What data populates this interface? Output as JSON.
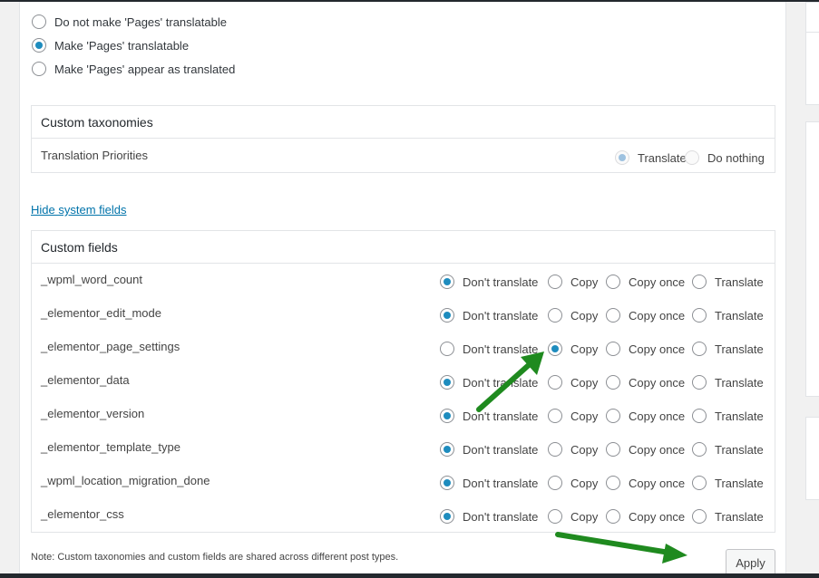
{
  "post_type_options": [
    {
      "label": "Do not make 'Pages' translatable",
      "checked": false
    },
    {
      "label": "Make 'Pages' translatable",
      "checked": true
    },
    {
      "label": "Make 'Pages' appear as translated",
      "checked": false
    }
  ],
  "custom_taxonomies": {
    "title": "Custom taxonomies",
    "row_name": "Translation Priorities",
    "options": [
      "Translate",
      "Do nothing"
    ]
  },
  "hide_system_fields_link": "Hide system fields",
  "custom_fields": {
    "title": "Custom fields",
    "option_labels": [
      "Don't translate",
      "Copy",
      "Copy once",
      "Translate"
    ],
    "rows": [
      {
        "name": "_wpml_word_count",
        "selected": "Don't translate"
      },
      {
        "name": "_elementor_edit_mode",
        "selected": "Don't translate"
      },
      {
        "name": "_elementor_page_settings",
        "selected": "Copy"
      },
      {
        "name": "_elementor_data",
        "selected": "Don't translate"
      },
      {
        "name": "_elementor_version",
        "selected": "Don't translate"
      },
      {
        "name": "_elementor_template_type",
        "selected": "Don't translate"
      },
      {
        "name": "_wpml_location_migration_done",
        "selected": "Don't translate"
      },
      {
        "name": "_elementor_css",
        "selected": "Don't translate"
      }
    ]
  },
  "note": "Note: Custom taxonomies and custom fields are shared across different post types.",
  "apply_label": "Apply",
  "colors": {
    "accent": "#1e8cbe",
    "link": "#0073aa",
    "arrow": "#1f8a1f"
  }
}
